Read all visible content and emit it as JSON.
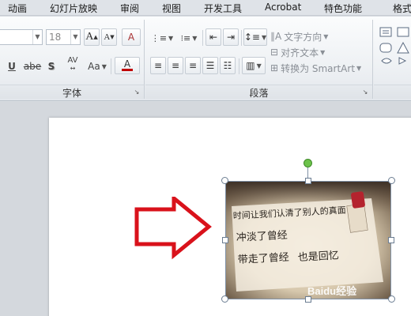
{
  "menu": {
    "tabs": [
      "动画",
      "幻灯片放映",
      "审阅",
      "视图",
      "开发工具",
      "Acrobat",
      "特色功能",
      "格式"
    ]
  },
  "ribbon": {
    "font_group": {
      "label": "字体",
      "font_size": "18",
      "strike_label": "abe",
      "shadow_label": "S",
      "spacing_label": "AV",
      "case_label": "Aa",
      "underline_label": "U",
      "grow_label": "A",
      "shrink_label": "A",
      "color_label": "A",
      "clear_label": "A"
    },
    "paragraph_group": {
      "label": "段落",
      "text_direction": "文字方向",
      "align_text": "对齐文本",
      "convert_smartart": "转换为 SmartArt"
    },
    "drawing_group": {
      "label": ""
    }
  },
  "watermark": {
    "text": "Baidu经验"
  },
  "photo": {
    "handwriting": [
      "时间让我们认清了别人的真面",
      "冲淡了曾经",
      "带走了曾经",
      "也是回忆"
    ]
  },
  "colors": {
    "arrow_red": "#d9121b",
    "rotate_handle": "#6cc24a",
    "accent": "#c42030"
  }
}
